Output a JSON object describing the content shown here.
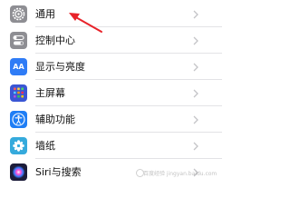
{
  "settings": {
    "items": [
      {
        "label": "通用",
        "icon": "gear-icon",
        "color": "#8e8e93"
      },
      {
        "label": "控制中心",
        "icon": "control-center-icon",
        "color": "#8e8e93"
      },
      {
        "label": "显示与亮度",
        "icon": "display-aa-icon",
        "color": "#2f7cf6",
        "icon_text": "AA"
      },
      {
        "label": "主屏幕",
        "icon": "home-screen-icon",
        "color": "#3a56d4"
      },
      {
        "label": "辅助功能",
        "icon": "accessibility-icon",
        "color": "#1f7ef5"
      },
      {
        "label": "墙纸",
        "icon": "wallpaper-icon",
        "color": "#35aadc"
      },
      {
        "label": "Siri与搜索",
        "icon": "siri-icon",
        "color": "#1c1c3a"
      }
    ]
  },
  "annotation": {
    "arrow_color": "#e8232a"
  },
  "watermark": {
    "text": "百度经验 jingyan.baidu.com"
  }
}
